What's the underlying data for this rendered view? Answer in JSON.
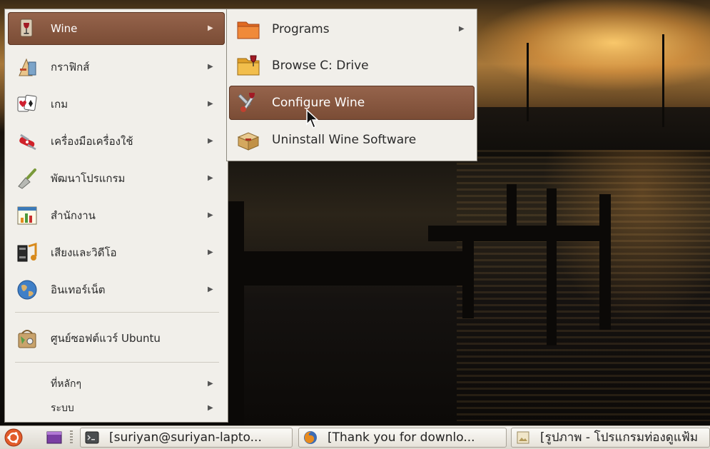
{
  "menu": {
    "items": [
      {
        "label": "Wine",
        "icon": "wine-glass-icon",
        "has_submenu": true,
        "active": true
      },
      {
        "label": "กราฟิกส์",
        "icon": "graphics-icon",
        "has_submenu": true
      },
      {
        "label": "เกม",
        "icon": "cards-icon",
        "has_submenu": true
      },
      {
        "label": "เครื่องมือเครื่องใช้",
        "icon": "swiss-knife-icon",
        "has_submenu": true
      },
      {
        "label": "พัฒนาโปรแกรม",
        "icon": "trowel-icon",
        "has_submenu": true
      },
      {
        "label": "สำนักงาน",
        "icon": "office-chart-icon",
        "has_submenu": true
      },
      {
        "label": "เสียงและวิดีโอ",
        "icon": "multimedia-icon",
        "has_submenu": true
      },
      {
        "label": "อินเทอร์เน็ต",
        "icon": "globe-icon",
        "has_submenu": true
      },
      {
        "label": "ศูนย์ซอฟต์แวร์ Ubuntu",
        "icon": "software-center-icon",
        "has_submenu": false
      },
      {
        "label": "ที่หลักๆ",
        "has_submenu": true
      },
      {
        "label": "ระบบ",
        "has_submenu": true
      }
    ]
  },
  "submenu": {
    "items": [
      {
        "label": "Programs",
        "icon": "folder-icon",
        "has_submenu": true
      },
      {
        "label": "Browse C: Drive",
        "icon": "wine-folder-icon"
      },
      {
        "label": "Configure Wine",
        "icon": "wine-config-icon",
        "active": true
      },
      {
        "label": "Uninstall Wine Software",
        "icon": "package-icon"
      }
    ]
  },
  "taskbar": {
    "buttons": [
      {
        "label": "[suriyan@suriyan-lapto...",
        "icon": "terminal-icon"
      },
      {
        "label": "[Thank you for downlo...",
        "icon": "firefox-icon"
      },
      {
        "label": "[รูปภาพ - โปรแกรมท่องดูแฟ้ม",
        "icon": "image-viewer-icon"
      }
    ]
  },
  "colors": {
    "highlight": "#8a5a42",
    "menu_bg": "#f1efea"
  }
}
